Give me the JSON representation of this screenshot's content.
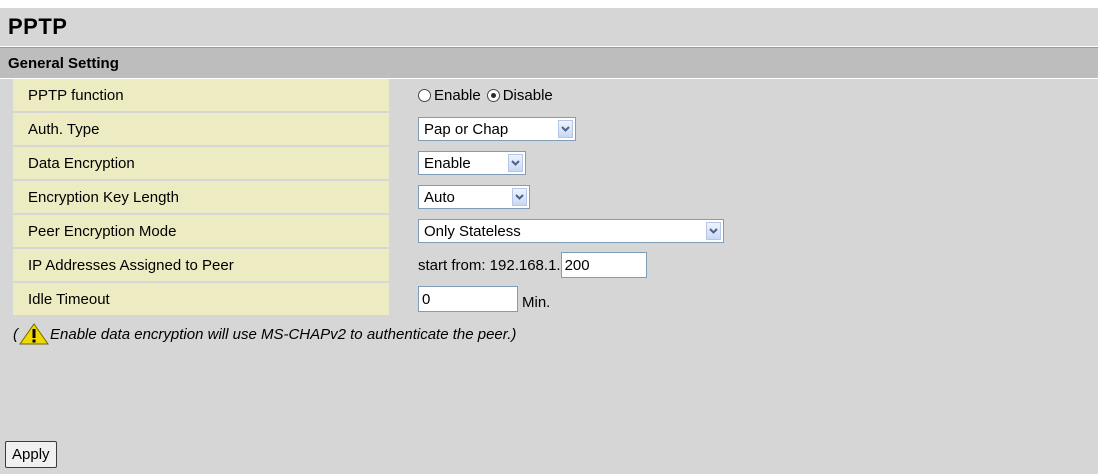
{
  "page": {
    "title": "PPTP",
    "section": "General Setting"
  },
  "rows": {
    "pptp_function": {
      "label": "PPTP function",
      "option_enable": "Enable",
      "option_disable": "Disable",
      "selected": "Disable"
    },
    "auth_type": {
      "label": "Auth. Type",
      "value": "Pap or Chap"
    },
    "data_encryption": {
      "label": "Data Encryption",
      "value": "Enable"
    },
    "key_length": {
      "label": "Encryption Key Length",
      "value": "Auto"
    },
    "peer_mode": {
      "label": "Peer Encryption Mode",
      "value": "Only Stateless"
    },
    "ip_assigned": {
      "label": "IP Addresses Assigned to Peer",
      "prefix": "start from: 192.168.1.",
      "value": "200"
    },
    "idle_timeout": {
      "label": "Idle Timeout",
      "value": "0",
      "unit": "Min."
    }
  },
  "note": {
    "open": "(",
    "text": "Enable data encryption will use MS-CHAPv2 to authenticate the peer.)",
    "icon": "warning-icon"
  },
  "apply_label": "Apply",
  "colors": {
    "label_bg": "#ecebc2",
    "frame_bg": "#d6d6d6",
    "section_bg": "#bdbdbd"
  }
}
